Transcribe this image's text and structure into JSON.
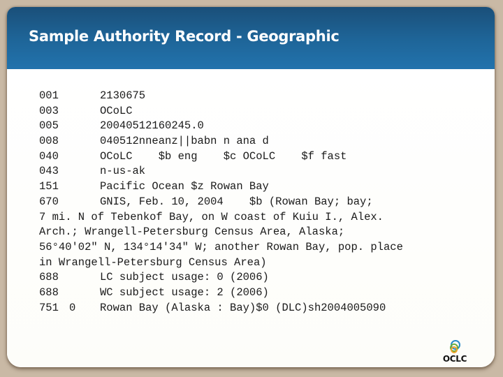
{
  "slide": {
    "title": "Sample Authority Record - Geographic"
  },
  "record": {
    "fields": [
      {
        "tag": "001",
        "ind": "",
        "value": "2130675"
      },
      {
        "tag": "003",
        "ind": "",
        "value": "OCoLC"
      },
      {
        "tag": "005",
        "ind": "",
        "value": "20040512160245.0"
      },
      {
        "tag": "008",
        "ind": "",
        "value": "040512nneanz||babn n ana d"
      },
      {
        "tag": "040",
        "ind": "",
        "value": "OCoLC    $b eng    $c OCoLC    $f fast"
      },
      {
        "tag": "043",
        "ind": "",
        "value": "n-us-ak"
      },
      {
        "tag": "151",
        "ind": "",
        "value": "Pacific Ocean $z Rowan Bay"
      },
      {
        "tag": "670",
        "ind": "",
        "value": "GNIS, Feb. 10, 2004    $b (Rowan Bay; bay;"
      },
      {
        "tag": "",
        "ind": "",
        "value": "7 mi. N of Tebenkof Bay, on W coast of Kuiu I., Alex."
      },
      {
        "tag": "",
        "ind": "",
        "value": "Arch.; Wrangell-Petersburg Census Area, Alaska;"
      },
      {
        "tag": "",
        "ind": "",
        "value": "56°40'02\" N, 134°14'34\" W; another Rowan Bay, pop. place"
      },
      {
        "tag": "",
        "ind": "",
        "value": "in Wrangell-Petersburg Census Area)"
      },
      {
        "tag": "688",
        "ind": "",
        "value": "LC subject usage: 0 (2006)"
      },
      {
        "tag": "688",
        "ind": "",
        "value": "WC subject usage: 2 (2006)"
      },
      {
        "tag": "751",
        "ind": "0",
        "value": "Rowan Bay (Alaska : Bay)$0 (DLC)sh2004005090"
      }
    ]
  },
  "logo": {
    "text": "OCLC",
    "icon": "oclc-rings-icon",
    "colors": [
      "#2a8bc8",
      "#6aab3e",
      "#f2a42c"
    ]
  }
}
